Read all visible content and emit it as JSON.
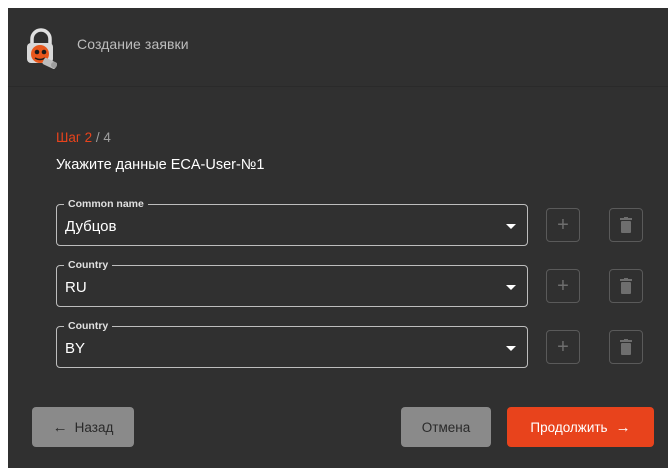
{
  "header": {
    "title": "Создание заявки",
    "logo_icon": "lock-robot-icon"
  },
  "step": {
    "label_prefix": "Шаг",
    "current": "2",
    "separator": " / ",
    "total": "4",
    "title": "Укажите данные ECA-User-№1"
  },
  "fields": [
    {
      "legend": "Common name",
      "value": "Дубцов"
    },
    {
      "legend": "Country",
      "value": "RU"
    },
    {
      "legend": "Country",
      "value": "BY"
    }
  ],
  "footer": {
    "back_label": "Назад",
    "cancel_label": "Отмена",
    "continue_label": "Продолжить"
  },
  "colors": {
    "accent": "#e8431c",
    "background": "#303030",
    "button_gray": "#8a8a8a"
  }
}
